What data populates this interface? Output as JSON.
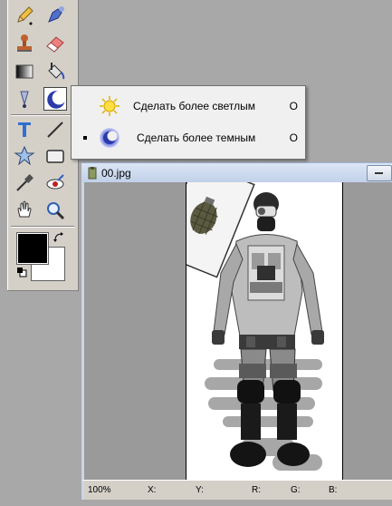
{
  "toolbox": {
    "tools": [
      {
        "id": "pencil",
        "icon": "pencil-icon"
      },
      {
        "id": "pen",
        "icon": "pen-icon"
      },
      {
        "id": "clone-stamp",
        "icon": "stamp-icon"
      },
      {
        "id": "eraser",
        "icon": "eraser-icon"
      },
      {
        "id": "gradient",
        "icon": "gradient-icon"
      },
      {
        "id": "paint-bucket",
        "icon": "paint-bucket-icon"
      },
      {
        "id": "blur",
        "icon": "blur-icon"
      },
      {
        "id": "burn",
        "icon": "burn-moon-icon",
        "active": true
      },
      {
        "id": "text",
        "icon": "text-tool-icon"
      },
      {
        "id": "line",
        "icon": "line-tool-icon"
      },
      {
        "id": "shape",
        "icon": "shape-tool-icon"
      },
      {
        "id": "rect",
        "icon": "rectangle-tool-icon"
      },
      {
        "id": "eyedropper",
        "icon": "eyedropper-icon"
      },
      {
        "id": "red-eye",
        "icon": "red-eye-icon"
      },
      {
        "id": "hand",
        "icon": "hand-icon"
      },
      {
        "id": "zoom",
        "icon": "zoom-icon"
      }
    ],
    "foreground_color": "#000000",
    "background_color": "#ffffff"
  },
  "flyout": {
    "items": [
      {
        "label": "Сделать более светлым",
        "shortcut": "O",
        "icon": "sun-icon",
        "selected": false
      },
      {
        "label": "Сделать более темным",
        "shortcut": "O",
        "icon": "moon-icon",
        "selected": true
      }
    ]
  },
  "document": {
    "title": "00.jpg"
  },
  "statusbar": {
    "zoom": "100%",
    "x_label": "X:",
    "y_label": "Y:",
    "r_label": "R:",
    "g_label": "G:",
    "b_label": "B:"
  },
  "colors": {
    "workspace": "#a8a8a8",
    "panel": "#d4d0c8",
    "titlebar": "#c0d0e8",
    "accent_moon": "#2a3aa8"
  }
}
